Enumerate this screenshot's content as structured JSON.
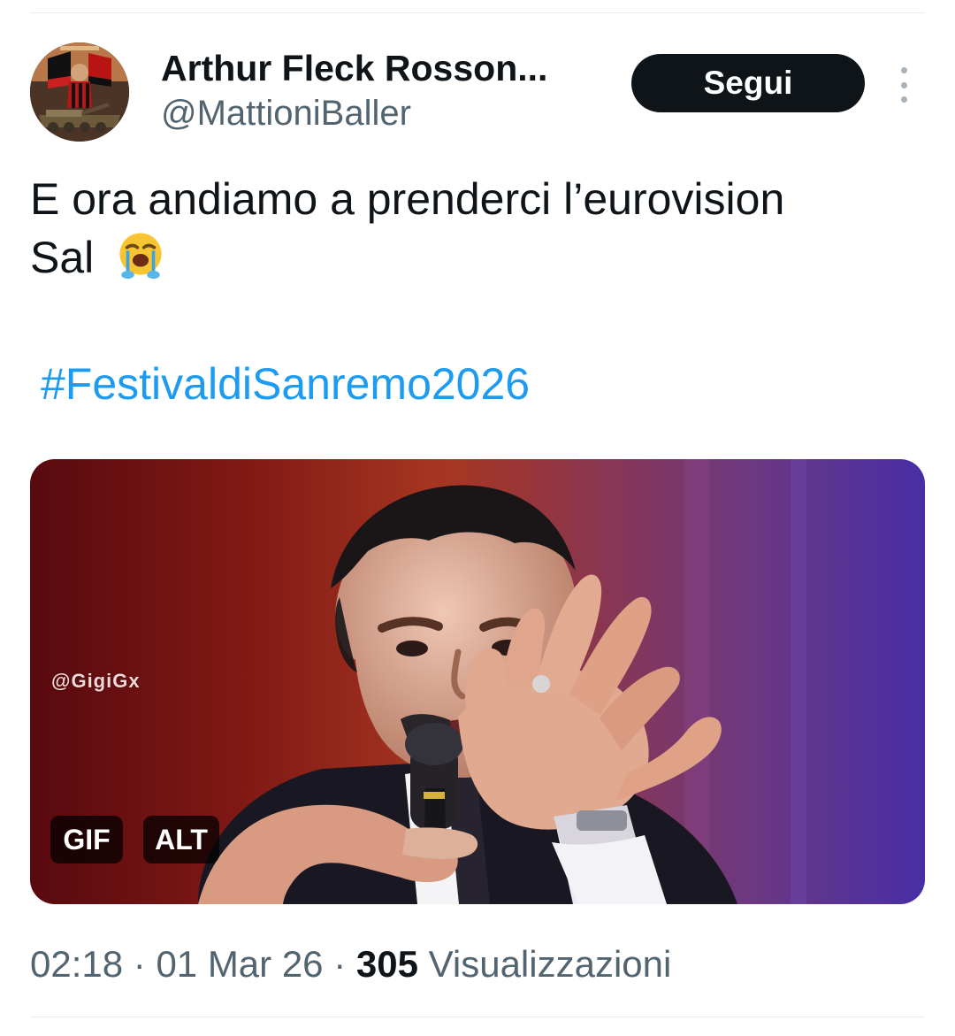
{
  "tweet": {
    "author": {
      "display_name": "Arthur Fleck Rosson...",
      "handle": "@MattioniBaller",
      "avatar_icon": "avatar-illustration"
    },
    "follow_button": {
      "label": "Segui"
    },
    "more_icon": "more-options-icon",
    "text_lines": [
      "E ora andiamo a prenderci l’eurovision",
      "Sal"
    ],
    "emoji": "😭",
    "hashtag": "#FestivaldiSanremo2026",
    "media": {
      "watermark": "@GigiGx",
      "gif_badge": "GIF",
      "alt_badge": "ALT",
      "image_icon": "singer-gif-frame"
    },
    "meta": {
      "time": "02:18",
      "separator_1": " · ",
      "date": "01 Mar 26",
      "separator_2": " · ",
      "views_count": "305",
      "views_label": " Visualizzazioni"
    }
  },
  "colors": {
    "text": "#0f1419",
    "secondary_text": "#536471",
    "link": "#1d9bf0",
    "button_bg": "#0f1419",
    "button_text": "#ffffff",
    "divider": "#e6ecf0"
  }
}
